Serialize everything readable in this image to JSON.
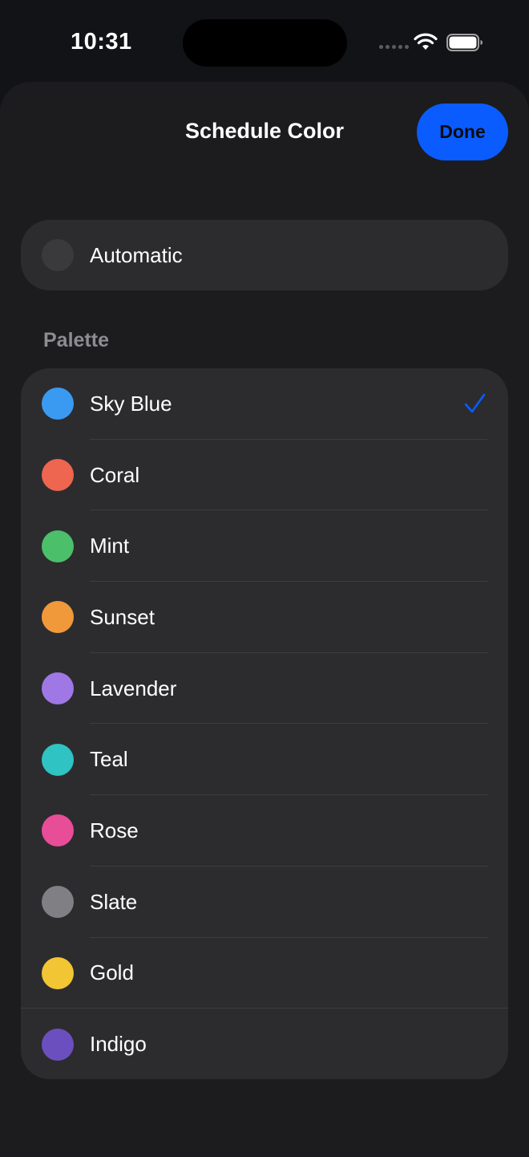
{
  "status_bar": {
    "time": "10:31"
  },
  "sheet": {
    "title": "Schedule Color",
    "done_label": "Done",
    "accent_color": "#0a5cff"
  },
  "automatic": {
    "label": "Automatic",
    "swatch": "#3a3a3c"
  },
  "palette": {
    "header": "Palette",
    "selected": "Sky Blue",
    "items": [
      {
        "label": "Sky Blue",
        "color": "#3a9af1"
      },
      {
        "label": "Coral",
        "color": "#ee6550"
      },
      {
        "label": "Mint",
        "color": "#4cbf6a"
      },
      {
        "label": "Sunset",
        "color": "#f0993a"
      },
      {
        "label": "Lavender",
        "color": "#9f78e6"
      },
      {
        "label": "Teal",
        "color": "#2fc3c3"
      },
      {
        "label": "Rose",
        "color": "#e84d98"
      },
      {
        "label": "Slate",
        "color": "#808084"
      },
      {
        "label": "Gold",
        "color": "#f2c534"
      },
      {
        "label": "Indigo",
        "color": "#6c4fbf"
      }
    ]
  }
}
